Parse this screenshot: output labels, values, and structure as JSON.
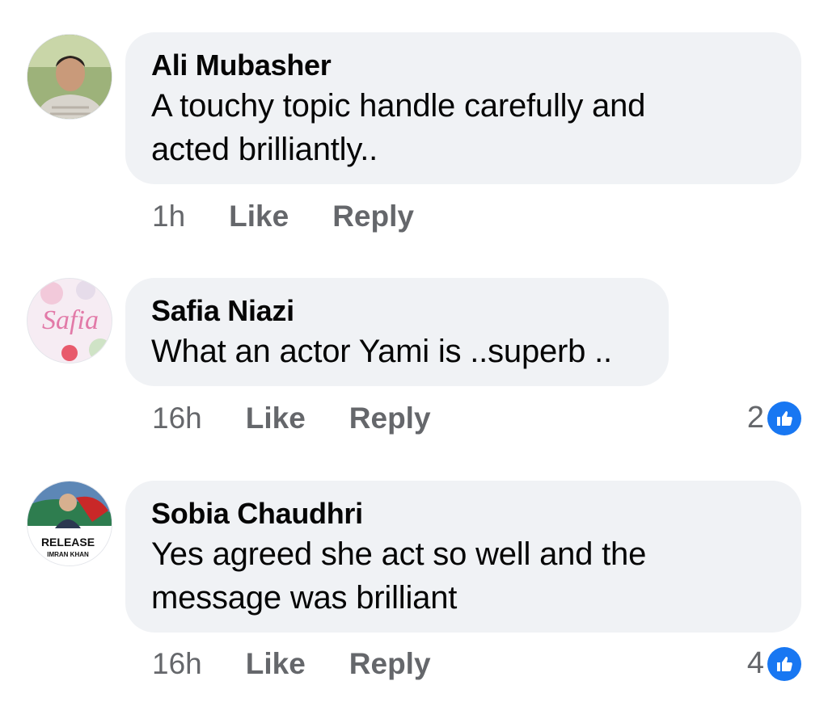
{
  "colors": {
    "accent": "#1877f2",
    "bubble": "#f0f2f5",
    "meta_text": "#65676b"
  },
  "comments": [
    {
      "author": "Ali Mubasher",
      "lines": [
        "A touchy topic handle carefully and",
        "acted brilliantly.."
      ],
      "time": "1h",
      "like_label": "Like",
      "reply_label": "Reply",
      "reactions": null
    },
    {
      "author": "Safia Niazi",
      "avatar_text": "Safia",
      "lines": [
        "What an actor Yami is ..superb .."
      ],
      "time": "16h",
      "like_label": "Like",
      "reply_label": "Reply",
      "reactions": {
        "count": "2",
        "icon": "thumbs-up-icon"
      }
    },
    {
      "author": "Sobia Chaudhri",
      "avatar_text": "RELEASE",
      "avatar_subtext": "IMRAN KHAN",
      "lines": [
        "Yes agreed she act so well and the",
        "message was brilliant"
      ],
      "time": "16h",
      "like_label": "Like",
      "reply_label": "Reply",
      "reactions": {
        "count": "4",
        "icon": "thumbs-up-icon"
      }
    }
  ]
}
